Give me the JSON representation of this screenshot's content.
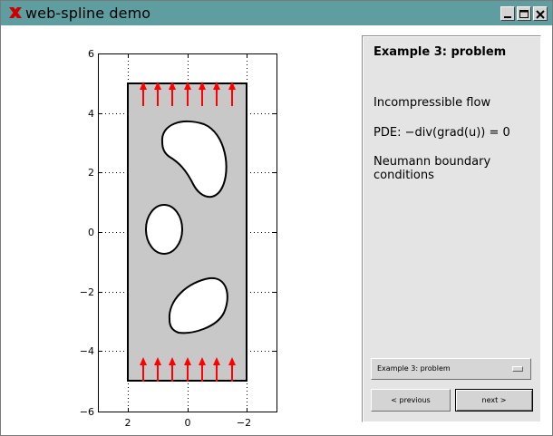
{
  "window": {
    "title": "web-spline demo"
  },
  "plot": {
    "y_ticks": [
      "6",
      "4",
      "2",
      "0",
      "−2",
      "−4",
      "−6"
    ],
    "x_ticks": [
      "2",
      "0",
      "−2"
    ],
    "colors": {
      "domain_fill": "#c8c8c8",
      "arrow": "#ff0000"
    }
  },
  "panel": {
    "title": "Example 3: problem",
    "line1": "Incompressible flow",
    "line2": "PDE: −div(grad(u)) = 0",
    "line3": "Neumann boundary conditions",
    "select_value": "Example 3: problem",
    "prev_label": "<  previous",
    "next_label": "next  >"
  }
}
